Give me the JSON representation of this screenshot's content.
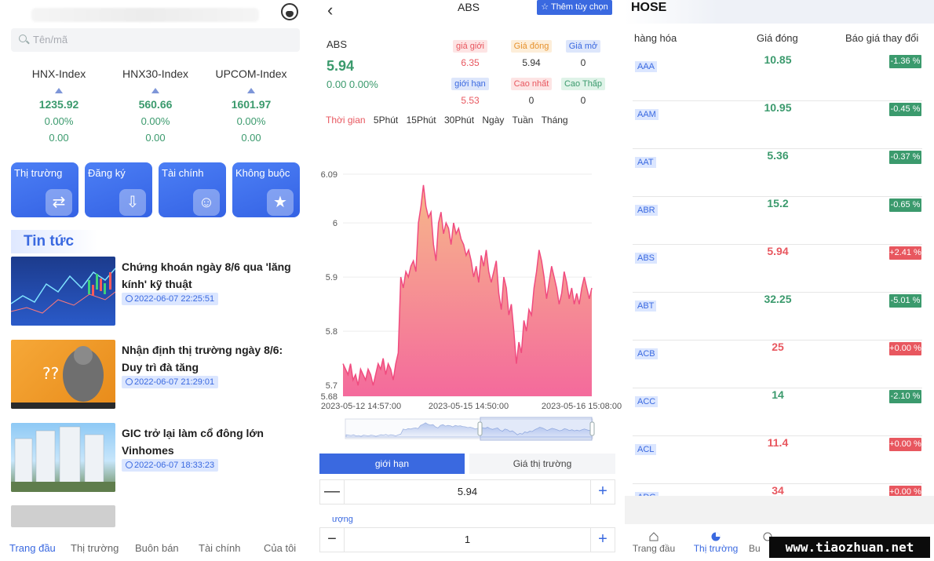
{
  "home": {
    "search_placeholder": "Tên/mã",
    "indices": [
      {
        "name": "HNX-Index",
        "value": "1235.92",
        "pct": "0.00%",
        "change": "0.00"
      },
      {
        "name": "HNX30-Index",
        "value": "560.66",
        "pct": "0.00%",
        "change": "0.00"
      },
      {
        "name": "UPCOM-Index",
        "value": "1601.97",
        "pct": "0.00%",
        "change": "0.00"
      }
    ],
    "tiles": [
      {
        "label": "Thị trường",
        "icon": "exchange-icon"
      },
      {
        "label": "Đăng ký",
        "icon": "download-icon"
      },
      {
        "label": "Tài chính",
        "icon": "id-card-icon"
      },
      {
        "label": "Không buộc",
        "icon": "star-icon"
      }
    ],
    "news_heading": "Tin tức",
    "news": [
      {
        "title": "Chứng khoán ngày 8/6 qua 'lăng kính' kỹ thuật",
        "time": "2022-06-07 22:25:51"
      },
      {
        "title": "Nhận định thị trường ngày 8/6: Duy trì đà tăng",
        "time": "2022-06-07 21:29:01"
      },
      {
        "title": "GIC trở lại làm cổ đông lớn Vinhomes",
        "time": "2022-06-07 18:33:23"
      }
    ],
    "nav": [
      "Trang đầu",
      "Thị trường",
      "Buôn bán",
      "Tài chính",
      "Của tôi"
    ]
  },
  "detail": {
    "title": "ABS",
    "add_option": "Thêm tùy chọn",
    "symbol": "ABS",
    "price": "5.94",
    "change": "0.00 0.00%",
    "quotes": [
      {
        "label": "giá giới",
        "value": "6.35",
        "color": "#e8575f",
        "bg": "#fde4e4"
      },
      {
        "label": "Giá đóng",
        "value": "5.94",
        "color": "#e6922e",
        "bg": "#fdeed9"
      },
      {
        "label": "Giá mở",
        "value": "0",
        "color": "#3a69e0",
        "bg": "#dde6fb"
      },
      {
        "label": "giới hạn",
        "value": "5.53",
        "color": "#3a69e0",
        "bg": "#dde6fb"
      },
      {
        "label": "Cao nhất",
        "value": "0",
        "color": "#e8575f",
        "bg": "#fde4e4"
      },
      {
        "label": "Cao Thấp",
        "value": "0",
        "color": "#3b9a6d",
        "bg": "#dff3e8"
      }
    ],
    "timeframes": [
      "Thời gian",
      "5Phút",
      "15Phút",
      "30Phút",
      "Ngày",
      "Tuần",
      "Tháng"
    ],
    "order_tabs": [
      "giới hạn",
      "Giá thị trường"
    ],
    "price_value": "5.94",
    "qty_label": "ượng",
    "qty_value": "1"
  },
  "chart_data": {
    "type": "area",
    "ylim": [
      5.68,
      6.09
    ],
    "y_ticks": [
      "6.09",
      "6",
      "5.9",
      "5.8",
      "5.7",
      "5.68"
    ],
    "x_ticks": [
      "2023-05-12 14:57:00",
      "2023-05-15 14:50:00",
      "2023-05-16 15:08:00"
    ],
    "series": [
      {
        "values": [
          5.74,
          5.73,
          5.72,
          5.74,
          5.71,
          5.72,
          5.7,
          5.73,
          5.72,
          5.71,
          5.73,
          5.72,
          5.7,
          5.72,
          5.74,
          5.73,
          5.75,
          5.72,
          5.74,
          5.73,
          5.71,
          5.74,
          5.76,
          5.9,
          5.88,
          5.91,
          5.9,
          5.92,
          5.93,
          5.91,
          6.0,
          6.03,
          6.07,
          6.03,
          6.01,
          6.02,
          5.96,
          5.93,
          6.0,
          6.02,
          5.98,
          6.0,
          5.99,
          5.96,
          6.0,
          5.98,
          5.99,
          5.97,
          5.96,
          5.94,
          5.95,
          5.93,
          5.9,
          5.92,
          5.89,
          5.94,
          5.92,
          5.95,
          5.91,
          5.89,
          5.91,
          5.93,
          5.87,
          5.84,
          5.9,
          5.88,
          5.83,
          5.85,
          5.8,
          5.74,
          5.78,
          5.76,
          5.82,
          5.8,
          5.84,
          5.83,
          5.88,
          5.91,
          5.95,
          5.93,
          5.9,
          5.86,
          5.89,
          5.92,
          5.9,
          5.88,
          5.85,
          5.87,
          5.91,
          5.89,
          5.86,
          5.88,
          5.85,
          5.87,
          5.85,
          5.88,
          5.9,
          5.88,
          5.86,
          5.88
        ]
      }
    ]
  },
  "market": {
    "tab": "HOSE",
    "headers": [
      "hàng hóa",
      "Giá đóng",
      "Báo giá thay đổi"
    ],
    "rows": [
      {
        "code": "AAA",
        "close": "10.85",
        "change": "-1.36 %",
        "dir": "down"
      },
      {
        "code": "AAM",
        "close": "10.95",
        "change": "-0.45 %",
        "dir": "down"
      },
      {
        "code": "AAT",
        "close": "5.36",
        "change": "-0.37 %",
        "dir": "down"
      },
      {
        "code": "ABR",
        "close": "15.2",
        "change": "-0.65 %",
        "dir": "down"
      },
      {
        "code": "ABS",
        "close": "5.94",
        "change": "+2.41 %",
        "dir": "up"
      },
      {
        "code": "ABT",
        "close": "32.25",
        "change": "-5.01 %",
        "dir": "down"
      },
      {
        "code": "ACB",
        "close": "25",
        "change": "+0.00 %",
        "dir": "up"
      },
      {
        "code": "ACC",
        "close": "14",
        "change": "-2.10 %",
        "dir": "down"
      },
      {
        "code": "ACL",
        "close": "11.4",
        "change": "+0.00 %",
        "dir": "up"
      },
      {
        "code": "ADG",
        "close": "34",
        "change": "+0.00 %",
        "dir": "up"
      }
    ],
    "nav": [
      "Trang đầu",
      "Thị trường",
      "Bu"
    ]
  },
  "watermark": "www.tiaozhuan.net"
}
